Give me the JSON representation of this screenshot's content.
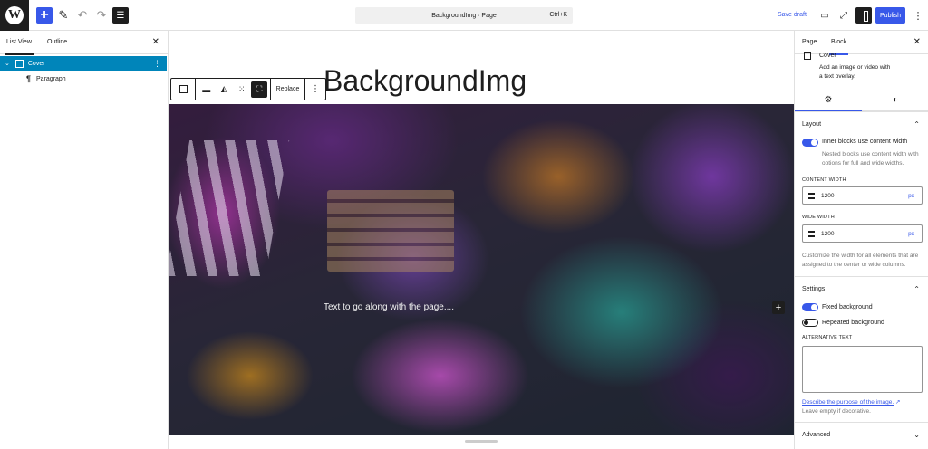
{
  "topbar": {
    "doc_title": "BackgroundImg · Page",
    "shortcut": "Ctrl+K",
    "save_draft": "Save draft",
    "publish": "Publish"
  },
  "list_view": {
    "tabs": [
      "List View",
      "Outline"
    ],
    "items": [
      {
        "label": "Cover",
        "selected": true
      },
      {
        "label": "Paragraph",
        "selected": false
      }
    ]
  },
  "canvas": {
    "page_title": "BackgroundImg",
    "toolbar_replace": "Replace",
    "cover_text": "Text to go along with the page...."
  },
  "inspector": {
    "tabs": [
      "Page",
      "Block"
    ],
    "block_name": "Cover",
    "block_description": "Add an image or video with a text overlay.",
    "layout": {
      "heading": "Layout",
      "inner_blocks_label": "Inner blocks use content width",
      "inner_blocks_help": "Nested blocks use content width with options for full and wide widths.",
      "content_width_label": "CONTENT WIDTH",
      "content_width_value": "1200",
      "wide_width_label": "WIDE WIDTH",
      "wide_width_value": "1200",
      "unit": "px",
      "width_help": "Customize the width for all elements that are assigned to the center or wide columns."
    },
    "settings": {
      "heading": "Settings",
      "fixed_background": "Fixed background",
      "repeated_background": "Repeated background",
      "alt_text_label": "ALTERNATIVE TEXT",
      "describe_link": "Describe the purpose of the image.",
      "leave_empty": "Leave empty if decorative."
    },
    "advanced": "Advanced"
  },
  "colors": {
    "accent": "#3858e9",
    "selection": "#0085ba",
    "dark": "#1e1e1e"
  }
}
